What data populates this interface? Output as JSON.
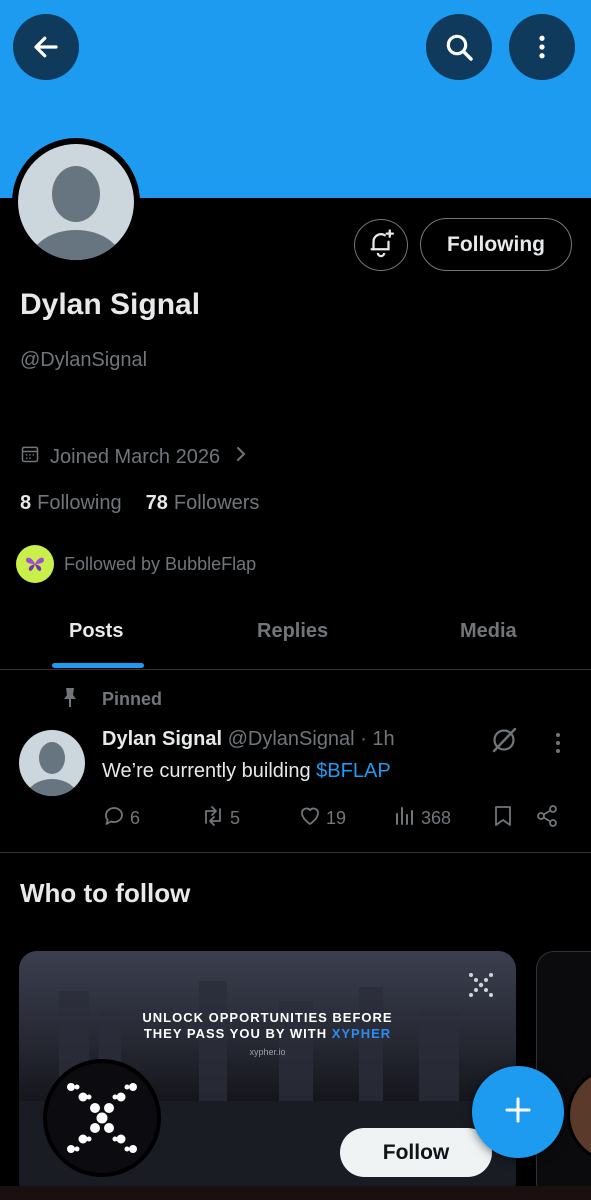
{
  "header": {
    "back_icon": "arrow-left-icon",
    "search_icon": "search-icon",
    "more_icon": "more-vertical-icon",
    "banner_color": "#1d9bf0"
  },
  "profile": {
    "name": "Dylan Signal",
    "handle": "@DylanSignal",
    "joined": "Joined March 2026",
    "following_count": "8",
    "following_label": "Following",
    "followers_count": "78",
    "followers_label": "Followers",
    "followed_by": "Followed by BubbleFlap",
    "following_button": "Following"
  },
  "tabs": [
    {
      "label": "Posts",
      "active": true
    },
    {
      "label": "Replies",
      "active": false
    },
    {
      "label": "Media",
      "active": false
    }
  ],
  "pinned_post": {
    "pinned_label": "Pinned",
    "author": "Dylan Signal",
    "handle": "@DylanSignal",
    "time": "· 1h",
    "text_prefix": "We’re currently building ",
    "cashtag": "$BFLAP",
    "replies": "6",
    "reposts": "5",
    "likes": "19",
    "views": "368"
  },
  "who_to_follow": {
    "title": "Who to follow",
    "card": {
      "headline_line1": "UNLOCK OPPORTUNITIES BEFORE",
      "headline_line2_prefix": "THEY PASS YOU BY WITH ",
      "headline_accent": "XYPHER",
      "url": "xypher.io",
      "follow_label": "Follow"
    }
  },
  "fab": {
    "icon": "plus-icon"
  },
  "colors": {
    "accent": "#1d9bf0",
    "muted": "#71767b",
    "text": "#e7e9ea"
  }
}
